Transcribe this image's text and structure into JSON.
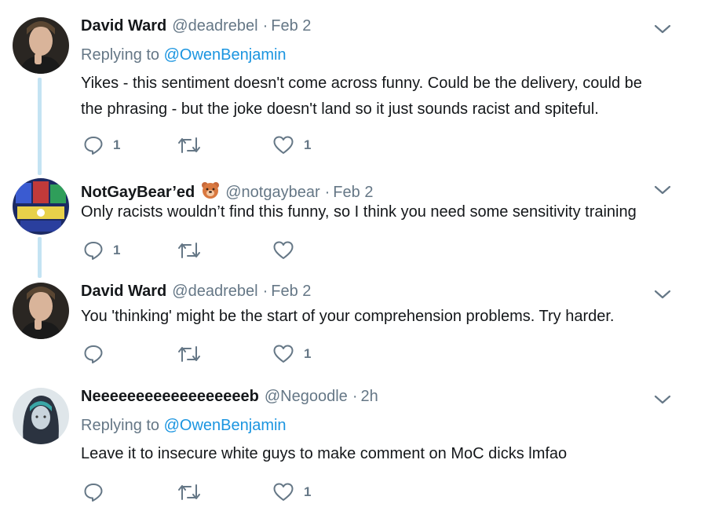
{
  "tweets": [
    {
      "name": "David Ward",
      "handle": "@deadrebel",
      "sep": "·",
      "date": "Feb 2",
      "replying_prefix": "Replying to",
      "replying_to": "@OwenBenjamin",
      "text_line1": "Yikes - this sentiment doesn't come across funny. Could be the delivery, could be",
      "text_line2": "the phrasing - but the joke doesn't land so it just sounds racist and spiteful.",
      "reply_count": "1",
      "retweet_count": "",
      "like_count": "1"
    },
    {
      "name": "NotGayBear’ed",
      "handle": "@notgaybear",
      "sep": "·",
      "date": "Feb 2",
      "text_line1": "Only racists wouldn’t find this funny, so I think you need some sensitivity training",
      "reply_count": "1",
      "retweet_count": "",
      "like_count": ""
    },
    {
      "name": "David Ward",
      "handle": "@deadrebel",
      "sep": "·",
      "date": "Feb 2",
      "text_line1": "You 'thinking' might be the start of your comprehension problems. Try harder.",
      "reply_count": "",
      "retweet_count": "",
      "like_count": "1"
    },
    {
      "name": "Neeeeeeeeeeeeeeeeeeb",
      "handle": "@Negoodle",
      "sep": "·",
      "date": "2h",
      "replying_prefix": "Replying to",
      "replying_to": "@OwenBenjamin",
      "text_line1": "Leave it to insecure white guys to make comment on MoC dicks lmfao",
      "reply_count": "",
      "retweet_count": "",
      "like_count": "1"
    }
  ],
  "colors": {
    "text": "#14171a",
    "muted": "#657786",
    "link": "#1b95e0",
    "thread_line": "#c4e3f3"
  },
  "icons": [
    "reply-icon",
    "retweet-icon",
    "like-icon",
    "chevron-down-icon",
    "bear-emoji"
  ]
}
